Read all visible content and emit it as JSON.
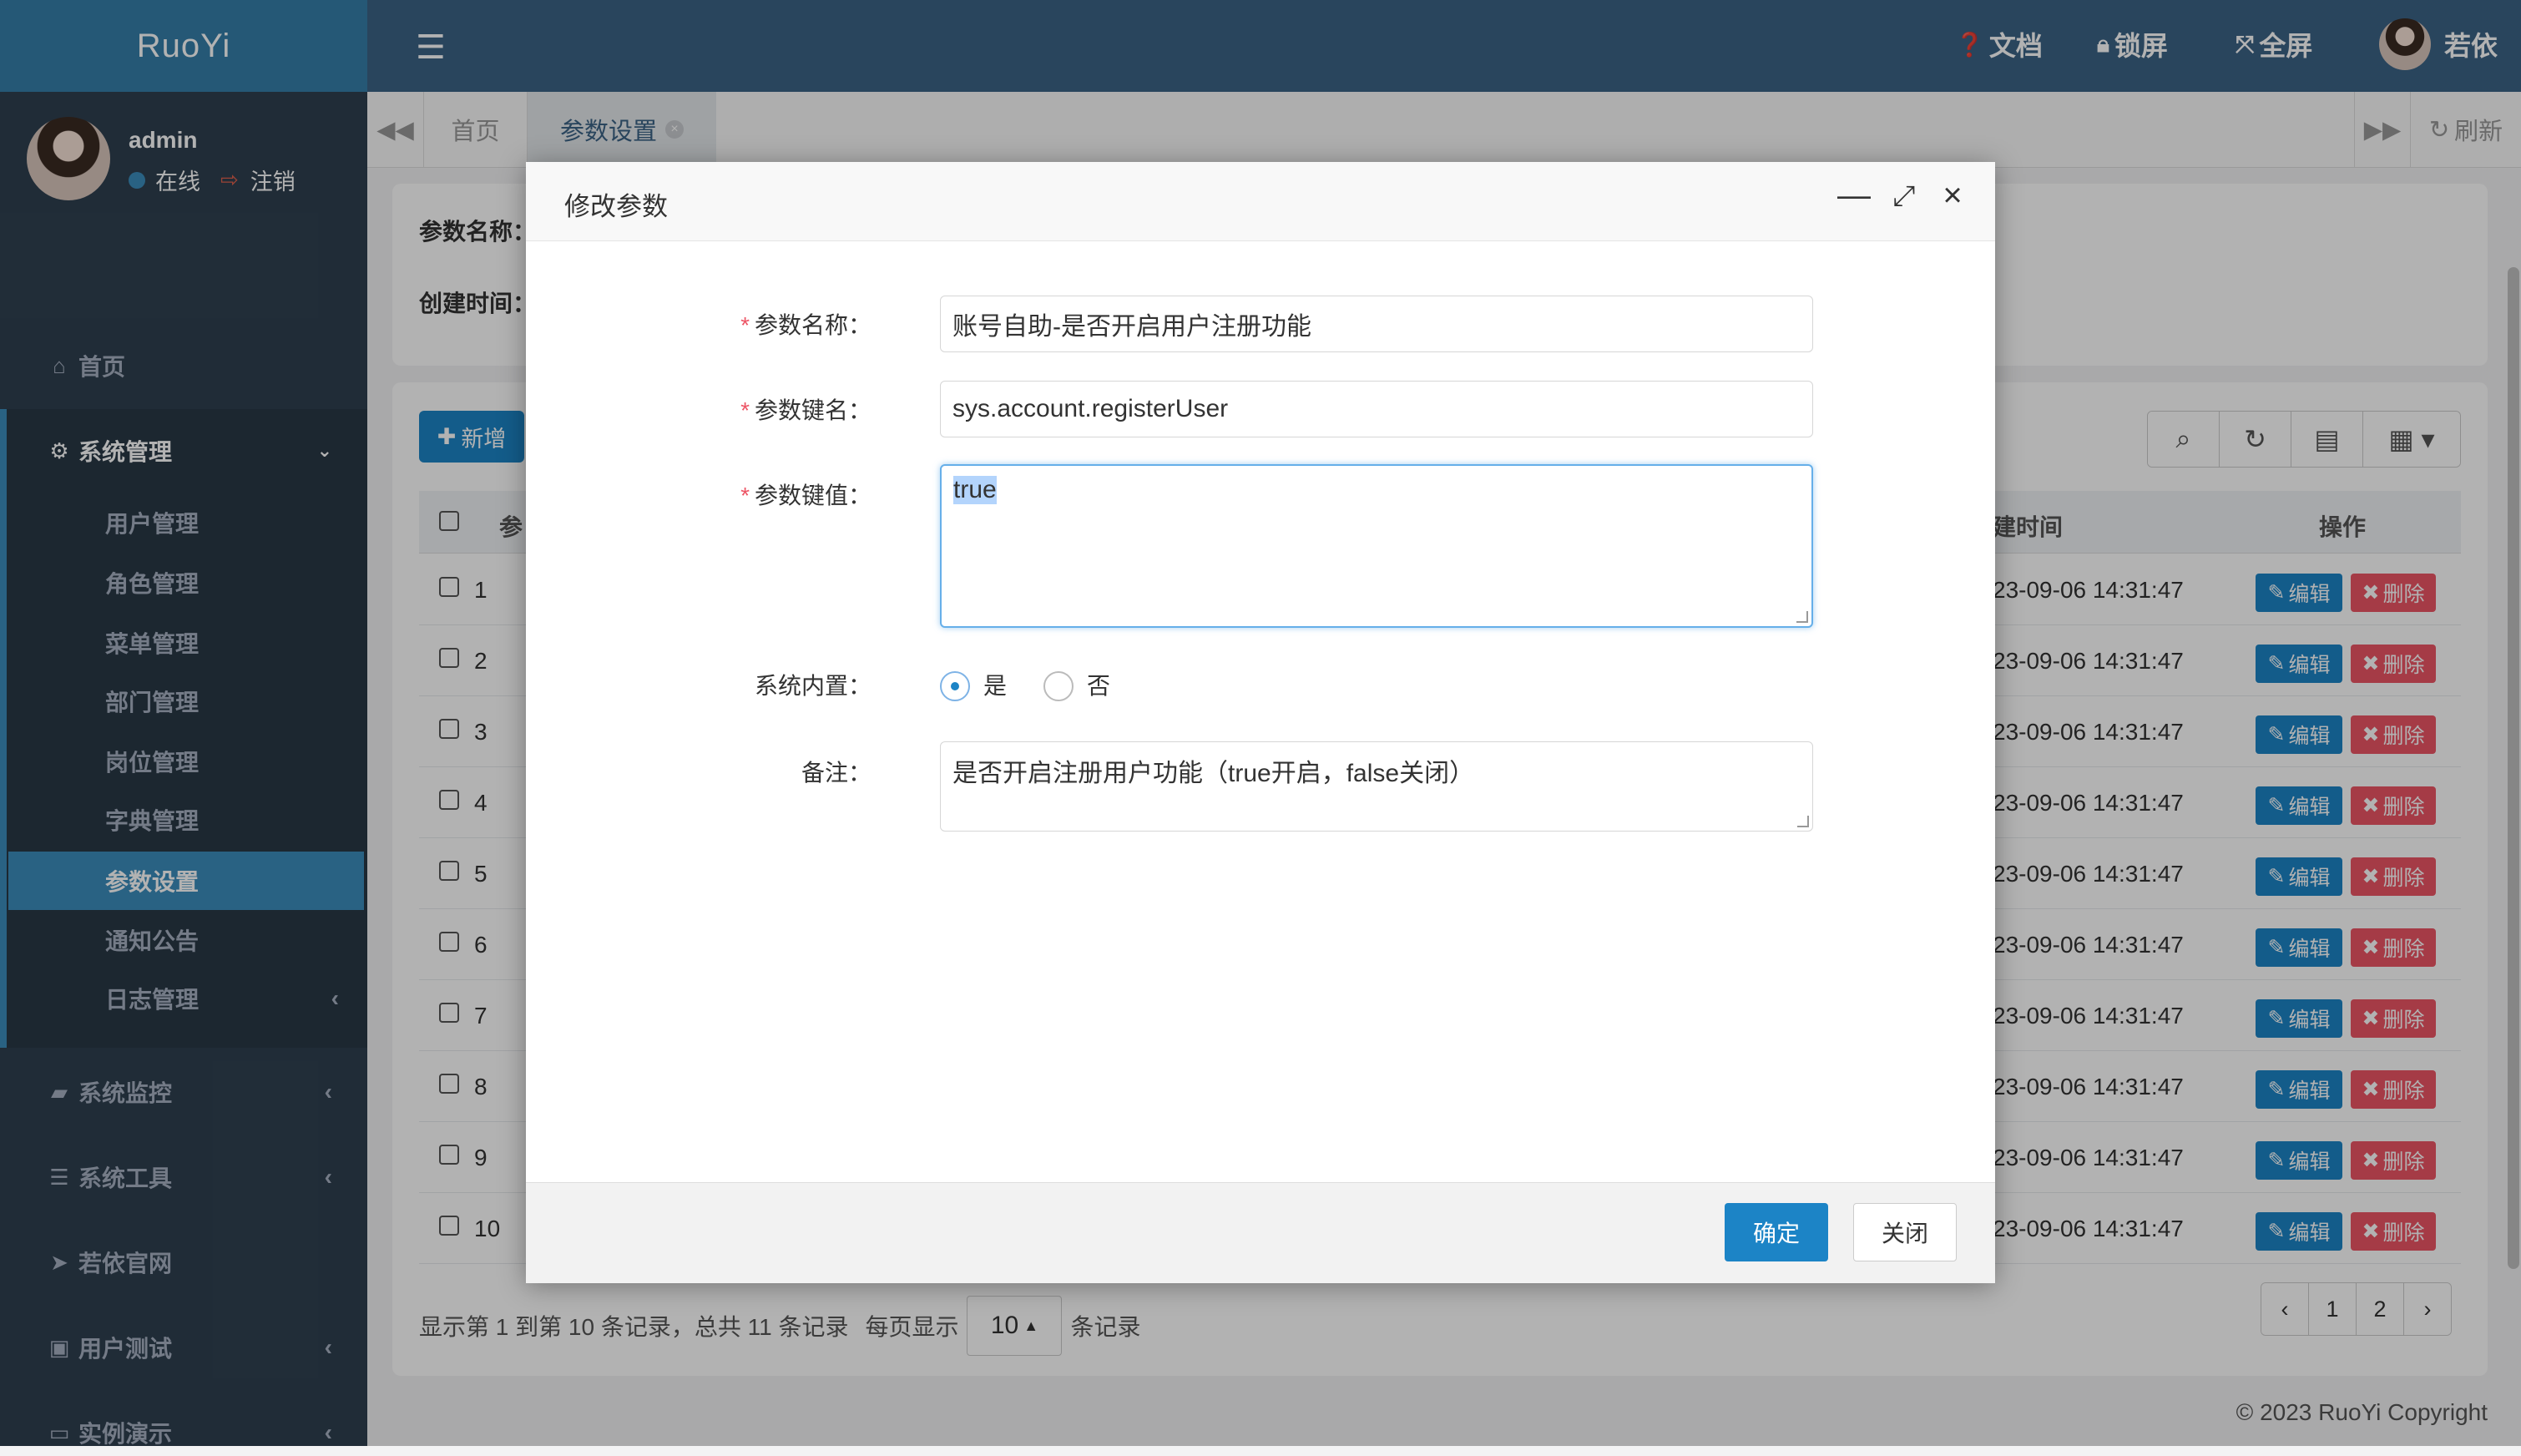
{
  "brand": "RuoYi",
  "user": {
    "name": "admin",
    "status": "在线",
    "logout": "注销"
  },
  "nav": {
    "home": "首页",
    "system": "系统管理",
    "system_items": [
      "用户管理",
      "角色管理",
      "菜单管理",
      "部门管理",
      "岗位管理",
      "字典管理",
      "参数设置",
      "通知公告",
      "日志管理"
    ],
    "active_item": "参数设置",
    "monitor": "系统监控",
    "tools": "系统工具",
    "official": "若依官网",
    "usertest": "用户测试",
    "demo": "实例演示"
  },
  "topbar": {
    "docs": "文档",
    "lock": "锁屏",
    "fullscreen": "全屏",
    "username": "若依"
  },
  "tabs": {
    "home": "首页",
    "config": "参数设置",
    "refresh": "刷新"
  },
  "search": {
    "name_label": "参数名称：",
    "time_label": "创建时间："
  },
  "table": {
    "add_label": "新增",
    "col_param": "参",
    "col_time": "建时间",
    "col_ops": "操作",
    "edit_label": "编辑",
    "delete_label": "删除",
    "rows": [
      {
        "no": "1",
        "time": "23-09-06 14:31:47"
      },
      {
        "no": "2",
        "time": "23-09-06 14:31:47"
      },
      {
        "no": "3",
        "time": "23-09-06 14:31:47"
      },
      {
        "no": "4",
        "time": "23-09-06 14:31:47"
      },
      {
        "no": "5",
        "time": "23-09-06 14:31:47"
      },
      {
        "no": "6",
        "time": "23-09-06 14:31:47"
      },
      {
        "no": "7",
        "time": "23-09-06 14:31:47"
      },
      {
        "no": "8",
        "time": "23-09-06 14:31:47"
      },
      {
        "no": "9",
        "time": "23-09-06 14:31:47"
      },
      {
        "no": "10",
        "time": "23-09-06 14:31:47"
      }
    ]
  },
  "pagination": {
    "info": "显示第 1 到第 10 条记录，总共 11 条记录",
    "per_page_label": "每页显示",
    "page_size": "10",
    "records_label": "条记录",
    "prev": "‹",
    "pages": [
      "1",
      "2"
    ],
    "next": "›"
  },
  "footer": {
    "copyright": "© 2023 RuoYi Copyright"
  },
  "modal": {
    "title": "修改参数",
    "name_label": "参数名称：",
    "name_value": "账号自助-是否开启用户注册功能",
    "key_label": "参数键名：",
    "key_value": "sys.account.registerUser",
    "val_label": "参数键值：",
    "val_value": "true",
    "builtin_label": "系统内置：",
    "builtin_yes": "是",
    "builtin_no": "否",
    "remark_label": "备注：",
    "remark_value": "是否开启注册用户功能（true开启，false关闭）",
    "ok": "确定",
    "close": "关闭"
  },
  "colors": {
    "primary": "#1c84c6",
    "danger": "#ed5565",
    "sidebar": "#2f4050",
    "topbar": "#3c6386",
    "active": "#3c8dbc"
  }
}
